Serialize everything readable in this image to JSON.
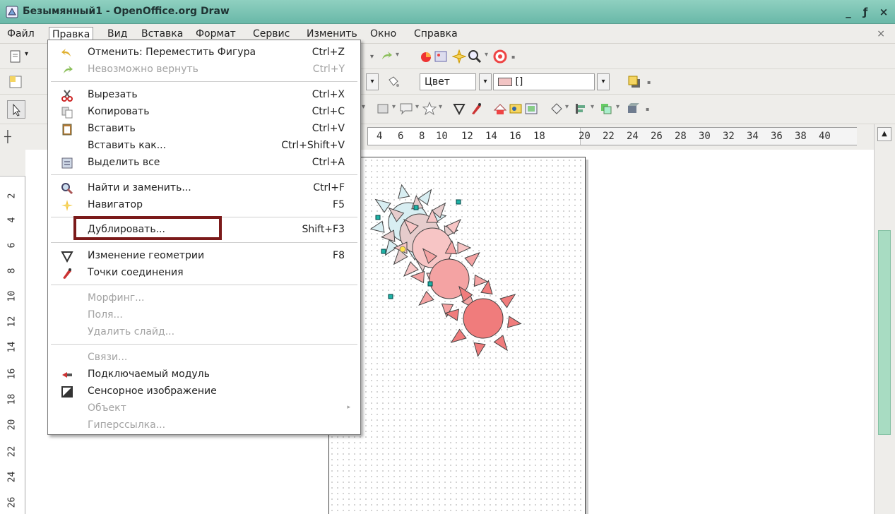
{
  "window": {
    "title": "Безымянный1 - OpenOffice.org Draw",
    "controls": [
      "_",
      "ƒ",
      "×"
    ]
  },
  "menubar": {
    "items": [
      "Файл",
      "Правка",
      "Вид",
      "Вставка",
      "Формат",
      "Сервис",
      "Изменить",
      "Окно",
      "Справка"
    ],
    "active": "Правка",
    "close": "×"
  },
  "toolbar2": {
    "color_combo": "Цвет",
    "color_value": "[]"
  },
  "ruler": {
    "h_ticks": [
      "4",
      "6",
      "8",
      "10",
      "12",
      "14",
      "16",
      "18",
      "20",
      "22",
      "24",
      "26",
      "28",
      "30",
      "32",
      "34",
      "36",
      "38",
      "40"
    ],
    "v_ticks": [
      "2",
      "4",
      "6",
      "8",
      "10",
      "12",
      "14",
      "16",
      "18",
      "20",
      "22",
      "24",
      "26"
    ]
  },
  "edit_menu": {
    "undo": {
      "label": "Отменить: Переместить Фигура",
      "shortcut": "Ctrl+Z"
    },
    "redo": {
      "label": "Невозможно вернуть",
      "shortcut": "Ctrl+Y"
    },
    "cut": {
      "label": "Вырезать",
      "shortcut": "Ctrl+X"
    },
    "copy": {
      "label": "Копировать",
      "shortcut": "Ctrl+C"
    },
    "paste": {
      "label": "Вставить",
      "shortcut": "Ctrl+V"
    },
    "paste_special": {
      "label": "Вставить как...",
      "shortcut": "Ctrl+Shift+V"
    },
    "select_all": {
      "label": "Выделить все",
      "shortcut": "Ctrl+A"
    },
    "find_replace": {
      "label": "Найти и заменить...",
      "shortcut": "Ctrl+F"
    },
    "navigator": {
      "label": "Навигатор",
      "shortcut": "F5"
    },
    "duplicate": {
      "label": "Дублировать...",
      "shortcut": "Shift+F3"
    },
    "edit_points": {
      "label": "Изменение геометрии",
      "shortcut": "F8"
    },
    "glue_points": {
      "label": "Точки соединения"
    },
    "morphing": {
      "label": "Морфинг..."
    },
    "fields": {
      "label": "Поля..."
    },
    "delete_slide": {
      "label": "Удалить слайд..."
    },
    "links": {
      "label": "Связи..."
    },
    "plugin": {
      "label": "Подключаемый модуль"
    },
    "image_map": {
      "label": "Сенсорное изображение"
    },
    "object": {
      "label": "Объект"
    },
    "hyperlink": {
      "label": "Гиперссылка..."
    }
  },
  "colors": {
    "titlebar": "#69b8a8",
    "sun_fill_dark": "#f07c7c",
    "sun_fill_mid": "#f4a3a3",
    "sun_fill_light": "#f7c5c5",
    "sun_fill_blue": "#d8eef2",
    "handle": "#1fb2a6",
    "highlight_box": "#7b1a1a"
  }
}
